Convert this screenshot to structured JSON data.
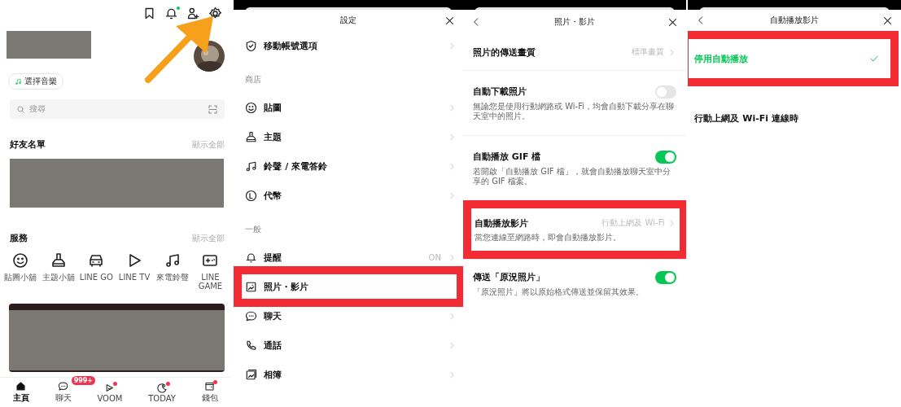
{
  "home": {
    "header_icons": [
      {
        "kind": "bookmark",
        "dot": false
      },
      {
        "kind": "bell",
        "dot": true
      },
      {
        "kind": "add-friend",
        "dot": false
      },
      {
        "kind": "settings",
        "dot": false
      }
    ],
    "music_chip": "選擇音樂",
    "search": {
      "placeholder": "搜尋"
    },
    "friends": {
      "title": "好友名單",
      "link": "顯示全部"
    },
    "services": {
      "title": "服務",
      "link": "顯示全部",
      "items": [
        {
          "kind": "sticker",
          "label": "貼圖小舖"
        },
        {
          "kind": "theme",
          "label": "主題小舖"
        },
        {
          "kind": "car",
          "label": "LINE GO"
        },
        {
          "kind": "play",
          "label": "LINE TV"
        },
        {
          "kind": "music",
          "label": "來電鈴聲"
        },
        {
          "kind": "game",
          "label": "LINE GAME"
        }
      ]
    },
    "tabs": [
      {
        "kind": "home",
        "label": "主頁",
        "selected": true,
        "dot": false
      },
      {
        "kind": "chat",
        "label": "聊天",
        "selected": false,
        "dot": false,
        "badge": "999+"
      },
      {
        "kind": "voom",
        "label": "VOOM",
        "selected": false,
        "dot": true
      },
      {
        "kind": "today",
        "label": "TODAY",
        "selected": false,
        "dot": true
      },
      {
        "kind": "wallet",
        "label": "錢包",
        "selected": false,
        "dot": true
      }
    ]
  },
  "settings": {
    "title": "設定",
    "items": [
      {
        "kind": "row",
        "label": "移動帳號選項",
        "chevron": true,
        "highlighted": false
      },
      {
        "kind": "header",
        "label": "商店"
      },
      {
        "kind": "row",
        "label": "貼圖",
        "chevron": true,
        "highlighted": false
      },
      {
        "kind": "row",
        "label": "主題",
        "chevron": true,
        "highlighted": false
      },
      {
        "kind": "row",
        "label": "鈴聲 / 來電答鈴",
        "chevron": true,
        "highlighted": false
      },
      {
        "kind": "row",
        "label": "代幣",
        "chevron": true,
        "highlighted": false
      },
      {
        "kind": "header",
        "label": "一般"
      },
      {
        "kind": "row",
        "label": "提醒",
        "value": "ON",
        "chevron": true,
        "highlighted": false
      },
      {
        "kind": "row",
        "label": "照片・影片",
        "chevron": false,
        "highlighted": true
      },
      {
        "kind": "row",
        "label": "聊天",
        "chevron": true,
        "highlighted": false
      },
      {
        "kind": "row",
        "label": "通話",
        "chevron": true,
        "highlighted": false
      },
      {
        "kind": "row",
        "label": "相簿",
        "chevron": true,
        "highlighted": false
      }
    ]
  },
  "photos": {
    "title": "照片・影片",
    "items": [
      {
        "kind": "link",
        "label": "照片的傳送畫質",
        "value": "標準畫質",
        "highlighted": false
      },
      {
        "kind": "toggle",
        "label": "自動下載照片",
        "description": "無論您是使用行動網路或 Wi-Fi，均會自動下載分享在聊天室中的照片。",
        "on": false
      },
      {
        "kind": "toggle",
        "label": "自動播放 GIF 檔",
        "description": "若開啟「自動播放 GIF 檔」，就會自動播放聊天室中分享的 GIF 檔案。",
        "on": true
      },
      {
        "kind": "link",
        "label": "自動播放影片",
        "value": "行動上網及 Wi-Fi",
        "description": "當您連線至網路時，即會自動播放影片。",
        "highlighted": true
      },
      {
        "kind": "toggle",
        "label": "傳送「原況照片」",
        "description": "「原況照片」將以原始格式傳送並保留其效果。",
        "on": true
      }
    ]
  },
  "autoplay": {
    "title": "自動播放影片",
    "options": [
      {
        "label": "停用自動播放",
        "selected": true,
        "highlighted": true
      },
      {
        "label": "行動上網及 Wi-Fi 連線時",
        "selected": false,
        "highlighted": false
      }
    ]
  }
}
